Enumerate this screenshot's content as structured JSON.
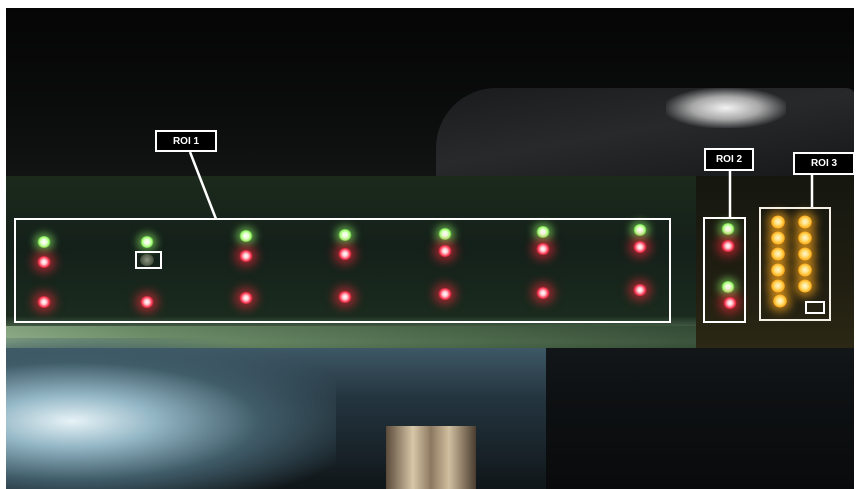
{
  "scene": {
    "roi_labels": [
      "ROI 1",
      "ROI 2",
      "ROI 3"
    ]
  }
}
